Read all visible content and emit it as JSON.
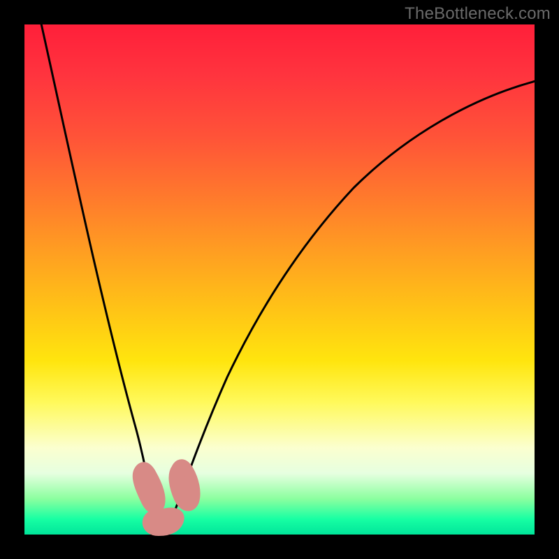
{
  "watermark": "TheBottleneck.com",
  "chart_data": {
    "type": "line",
    "title": "",
    "xlabel": "",
    "ylabel": "",
    "xlim": [
      0,
      100
    ],
    "ylim": [
      0,
      100
    ],
    "grid": false,
    "legend": false,
    "annotations": [],
    "series": [
      {
        "name": "bottleneck-curve",
        "x": [
          3,
          6,
          9,
          12,
          15,
          18,
          20,
          22,
          24,
          25,
          26,
          28,
          30,
          35,
          40,
          45,
          50,
          55,
          60,
          70,
          80,
          90,
          100
        ],
        "y": [
          100,
          84,
          68,
          54,
          40,
          26,
          17,
          10,
          5,
          2,
          2,
          5,
          10,
          23,
          34,
          44,
          52,
          59,
          65,
          74,
          80,
          85,
          88
        ]
      }
    ],
    "markers": [
      {
        "name": "left-ascending-marker",
        "x": 22.5,
        "y": 7.5
      },
      {
        "name": "optimum-marker",
        "x": 25.5,
        "y": 2.0
      },
      {
        "name": "right-ascending-marker",
        "x": 29.0,
        "y": 8.0
      }
    ]
  }
}
